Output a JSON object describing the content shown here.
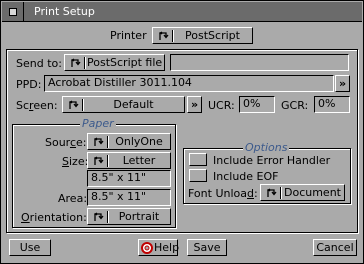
{
  "window": {
    "title": "Print Setup"
  },
  "printer": {
    "label": "Printer",
    "value": "PostScript"
  },
  "send_to": {
    "label": "Send to:",
    "value": "PostScript file",
    "path": ""
  },
  "ppd": {
    "label": "PPD:",
    "value": "Acrobat Distiller 3011.104",
    "browse_label": "»"
  },
  "screen": {
    "label_pre": "Sc",
    "label_u": "r",
    "label_post": "een:",
    "value": "Default",
    "more_label": "»",
    "ucr_label": "UCR:",
    "ucr_value": "0%",
    "gcr_label": "GCR:",
    "gcr_value": "0%"
  },
  "paper": {
    "title": "Paper",
    "source_label_pre": "Sour",
    "source_label_u": "c",
    "source_label_post": "e:",
    "source_value": "OnlyOne",
    "size_label_u": "S",
    "size_label_post": "ize:",
    "size_value": "Letter",
    "size_dims": "8.5\" x 11\"",
    "area_label": "Area:",
    "area_value": "8.5\" x 11\"",
    "orientation_label_u": "O",
    "orientation_label_post": "rientation:",
    "orientation_value": "Portrait"
  },
  "options": {
    "title": "Options",
    "error_handler_label": "Include Error Handler",
    "error_handler_checked": false,
    "eof_label": "Include EOF",
    "eof_checked": false,
    "font_unload_label_pre": "Font Unloa",
    "font_unload_label_u": "d",
    "font_unload_label_post": ":",
    "font_unload_value": "Document"
  },
  "buttons": {
    "use": "Use",
    "help": "Help",
    "save": "Save",
    "cancel": "Cancel"
  },
  "icons": {
    "cycle": "cycle-gadget-icon",
    "help": "help-lifebuoy-icon",
    "close": "close-icon"
  },
  "colors": {
    "window_bg": "#aaaaaa",
    "titlebar": "#6b6b6b",
    "group_title": "#3c5a8c"
  }
}
